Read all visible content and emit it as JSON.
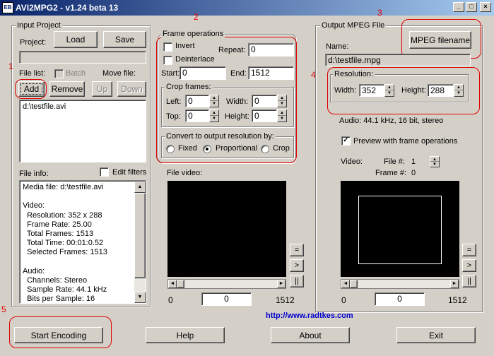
{
  "window": {
    "title": "AVI2MPG2 - v1.24 beta 13",
    "icon_text": "EB"
  },
  "input_project": {
    "group_label": "Input Project",
    "project_label": "Project:",
    "load_label": "Load",
    "save_label": "Save",
    "project_value": "",
    "file_list_label": "File list:",
    "batch_label": "Batch",
    "move_file_label": "Move file:",
    "add_label": "Add",
    "remove_label": "Remove",
    "up_label": "Up",
    "down_label": "Down",
    "files": [
      "d:\\testfile.avi"
    ],
    "file_info_label": "File info:",
    "edit_filters_label": "Edit filters",
    "file_info_text": "Media file: d:\\testfile.avi\n\nVideo:\n  Resolution: 352 x 288\n  Frame Rate: 25.00\n  Total Frames: 1513\n  Total Time: 00:01:0.52\n  Selected Frames: 1513\n\nAudio:\n  Channels: Stereo\n  Sample Rate: 44.1 kHz\n  Bits per Sample: 16"
  },
  "frame_operations": {
    "group_label": "Frame operations",
    "invert_label": "Invert",
    "deinterlace_label": "Deinterlace",
    "repeat_label": "Repeat:",
    "repeat_value": "0",
    "start_label": "Start:",
    "start_value": "0",
    "end_label": "End:",
    "end_value": "1512",
    "crop_group_label": "Crop frames:",
    "left_label": "Left:",
    "left_value": "0",
    "width_label": "Width:",
    "width_value": "0",
    "top_label": "Top:",
    "top_value": "0",
    "height_label": "Height:",
    "height_value": "0",
    "convert_group_label": "Convert to output resolution by:",
    "fixed_label": "Fixed",
    "proportional_label": "Proportional",
    "crop_label": "Crop",
    "selected_mode": "Proportional"
  },
  "file_video": {
    "label": "File video:",
    "position_start": "0",
    "position_value": "0",
    "position_end": "1512",
    "equals_btn": "=",
    "play_btn": ">",
    "pause_btn": "||"
  },
  "output": {
    "group_label": "Output MPEG File",
    "name_label": "Name:",
    "mpeg_filename_label": "MPEG filename",
    "name_value": "d:\\testfile.mpg",
    "resolution_group_label": "Resolution:",
    "width_label": "Width:",
    "width_value": "352",
    "height_label": "Height:",
    "height_value": "288",
    "audio_info": "Audio: 44.1 kHz, 16 bit, stereo",
    "preview_label": "Preview with frame operations",
    "preview_checked": true,
    "video_label": "Video:",
    "file_num_label": "File #:",
    "file_num_value": "1",
    "frame_num_label": "Frame #:",
    "frame_num_value": "0",
    "position_start": "0",
    "position_value": "0",
    "position_end": "1512",
    "equals_btn": "=",
    "play_btn": ">",
    "pause_btn": "||"
  },
  "footer": {
    "url": "http://www.radtkes.com",
    "start_encoding_label": "Start Encoding",
    "help_label": "Help",
    "about_label": "About",
    "exit_label": "Exit"
  },
  "annotations": {
    "n1": "1",
    "n2": "2",
    "n3": "3",
    "n4": "4",
    "n5": "5"
  },
  "colors": {
    "annotation": "#e00000",
    "title_gradient_start": "#0a246a",
    "link": "#0000cc"
  }
}
